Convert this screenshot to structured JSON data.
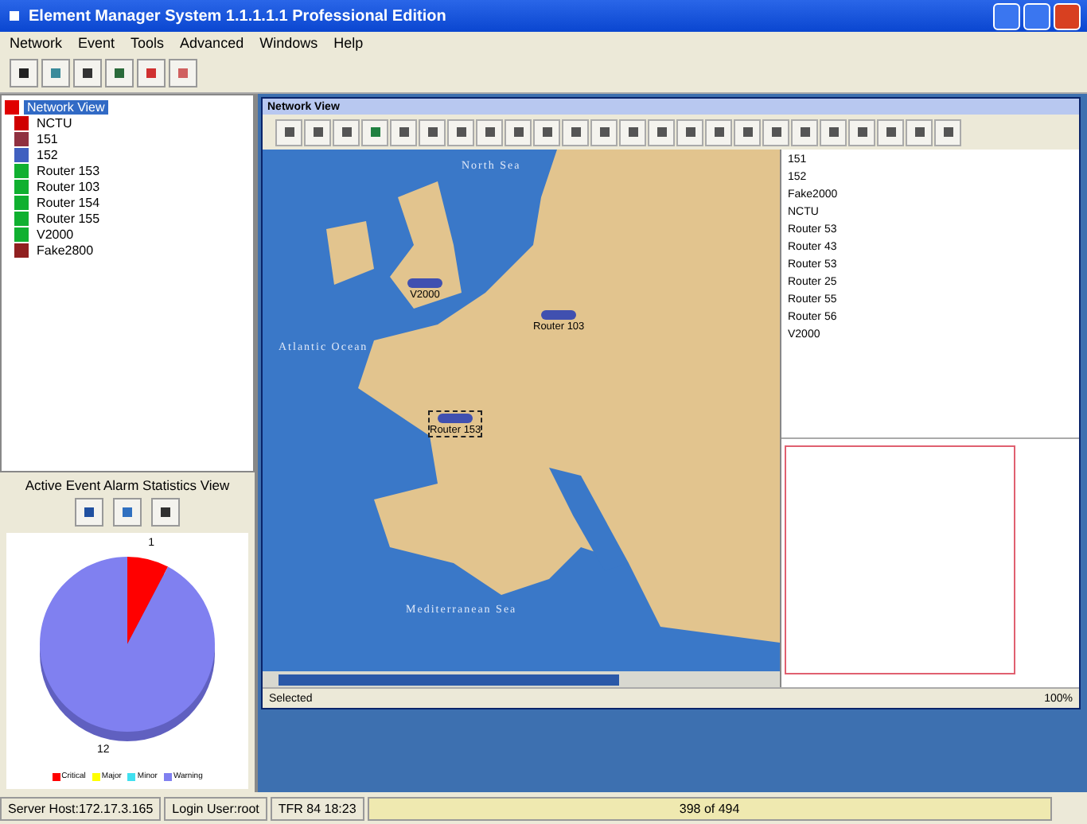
{
  "window": {
    "title": "Element Manager System 1.1.1.1.1 Professional Edition"
  },
  "menu": [
    "Network",
    "Event",
    "Tools",
    "Advanced",
    "Windows",
    "Help"
  ],
  "tree": {
    "items": [
      {
        "label": "Network View",
        "color": "#e00000",
        "selected": true
      },
      {
        "label": "NCTU",
        "color": "#d00000",
        "selected": false
      },
      {
        "label": "151",
        "color": "#903040",
        "selected": false
      },
      {
        "label": "152",
        "color": "#4060c0",
        "selected": false
      },
      {
        "label": "Router 153",
        "color": "#10b030",
        "selected": false
      },
      {
        "label": "Router 103",
        "color": "#10b030",
        "selected": false
      },
      {
        "label": "Router 154",
        "color": "#10b030",
        "selected": false
      },
      {
        "label": "Router 155",
        "color": "#10b030",
        "selected": false
      },
      {
        "label": "V2000",
        "color": "#10b030",
        "selected": false
      },
      {
        "label": "Fake2800",
        "color": "#902020",
        "selected": false
      }
    ]
  },
  "stats": {
    "title": "Active Event Alarm Statistics View",
    "chart_data": {
      "type": "pie",
      "categories": [
        "Critical",
        "Major",
        "Minor",
        "Warning"
      ],
      "values": [
        1,
        0,
        0,
        12
      ],
      "colors": [
        "#ff0000",
        "#ffff00",
        "#40e0f0",
        "#8080f0"
      ],
      "data_labels": true
    }
  },
  "network_view": {
    "title": "Network View",
    "map_labels": [
      "North Sea",
      "Atlantic Ocean",
      "Mediterranean Sea"
    ],
    "nodes": [
      {
        "label": "V2000",
        "selected": false
      },
      {
        "label": "Router 103",
        "selected": false
      },
      {
        "label": "Router 153",
        "selected": true
      }
    ],
    "device_list": [
      "151",
      "152",
      "Fake2000",
      "NCTU",
      "Router 53",
      "Router 43",
      "Router 53",
      "Router 25",
      "Router 55",
      "Router 56",
      "V2000"
    ],
    "status": "Selected",
    "zoom": "100%"
  },
  "status_bar": [
    "Server Host:172.17.3.165",
    "Login User:root",
    "TFR 84 18:23",
    "398 of 494"
  ]
}
